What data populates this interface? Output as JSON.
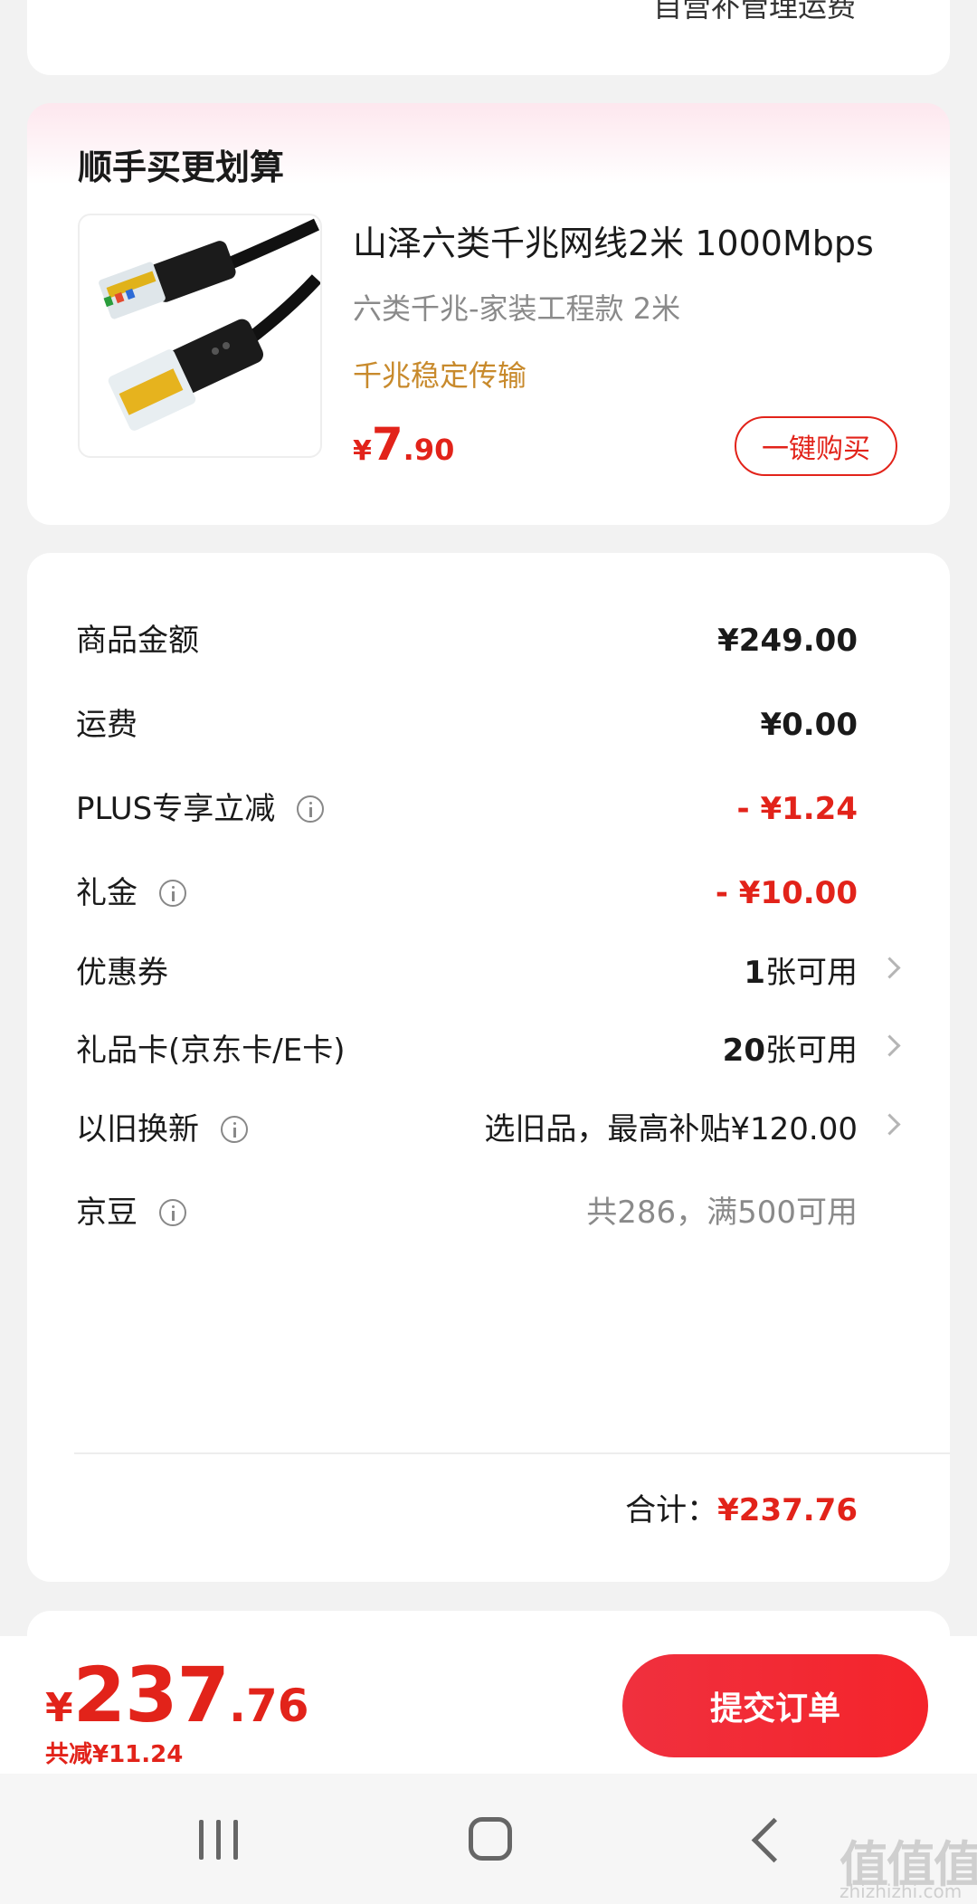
{
  "top_card": {
    "cut_text": "自营补管理运费"
  },
  "upsell": {
    "title": "顺手买更划算",
    "product": {
      "name": "山泽六类千兆网线2米 1000Mbps",
      "spec": "六类千兆-家装工程款   2米",
      "tag": "千兆稳定传输",
      "price_symbol": "¥",
      "price_int": "7",
      "price_dec": ".90",
      "buy_label": "一键购买"
    }
  },
  "summary": {
    "rows": [
      {
        "label": "商品金额",
        "value": "¥249.00"
      },
      {
        "label": "运费",
        "value": "¥0.00"
      },
      {
        "label": "PLUS专享立减",
        "value": "- ¥1.24"
      },
      {
        "label": "礼金",
        "value": "- ¥10.00"
      },
      {
        "label": "优惠券",
        "value_num": "1",
        "value_text": "张可用"
      },
      {
        "label": "礼品卡(京东卡/E卡)",
        "value_num": "20",
        "value_text": "张可用"
      },
      {
        "label": "以旧换新",
        "value": "选旧品，最高补贴¥120.00"
      },
      {
        "label": "京豆",
        "value": "共286，满500可用"
      }
    ],
    "total_label": "合计：",
    "total_value": "¥237.76"
  },
  "bottom_bar": {
    "price_symbol": "¥",
    "price_int": "237",
    "price_dec": ".76",
    "saved": "共减¥11.24",
    "submit_label": "提交订单"
  },
  "watermark": {
    "main": "值值值",
    "sub": "zhizhizhi.com"
  },
  "colors": {
    "accent_red": "#e2231a",
    "tag_gold": "#c88a2c",
    "background": "#f2f2f2"
  }
}
